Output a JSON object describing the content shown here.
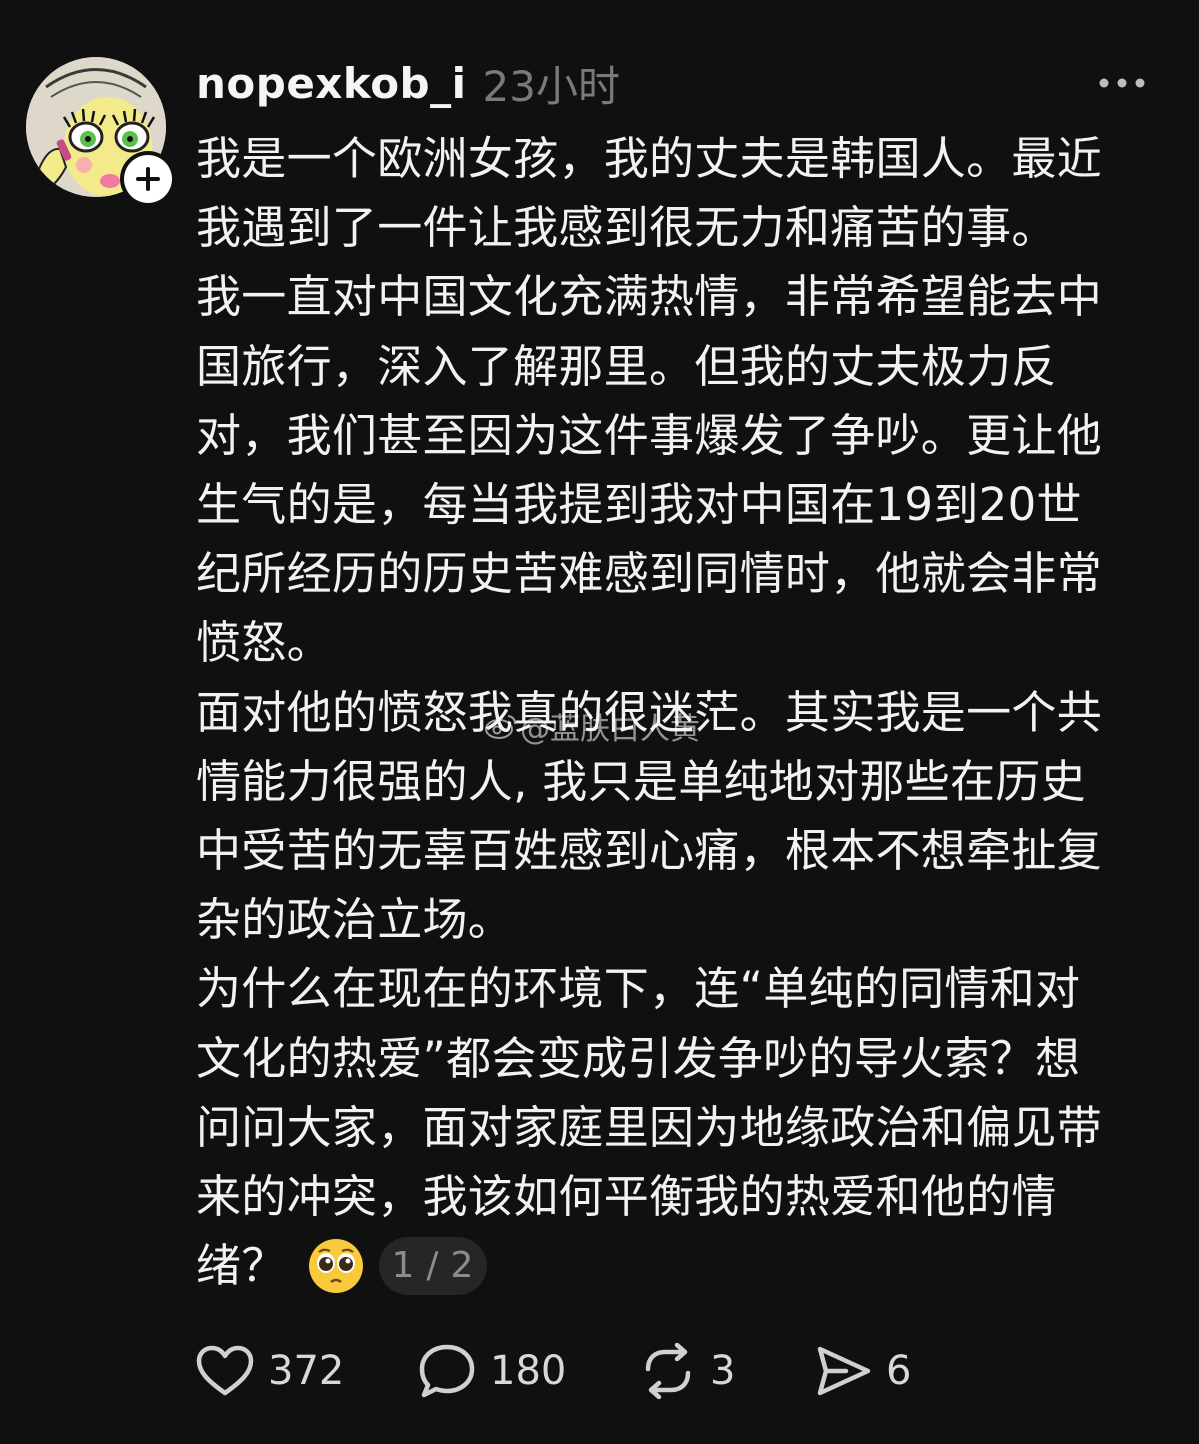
{
  "post": {
    "username": "nopexkob_i",
    "time": "23小时",
    "paragraphs": [
      "我是一个欧洲女孩，我的丈夫是韩国人。最近\n我遇到了一件让我感到很无力和痛苦的事。",
      "我一直对中国文化充满热情，非常希望能去中\n国旅行，深入了解那里。但我的丈夫极力反\n对，我们甚至因为这件事爆发了争吵。更让他\n生气的是，每当我提到我对中国在19到20世\n纪所经历的历史苦难感到同情时，他就会非常\n愤怒。",
      "面对他的愤怒我真的很迷茫。其实我是一个共\n情能力很强的人, 我只是单纯地对那些在历史\n中受苦的无辜百姓感到心痛，根本不想牵扯复\n杂的政治立场。",
      "为什么在现在的环境下，连“单纯的同情和对\n文化的热爱”都会变成引发争吵的导火索？想\n问问大家，面对家庭里因为地缘政治和偏见带\n来的冲突，我该如何平衡我的热爱和他的情"
    ],
    "last_line_text": "绪？",
    "emoji": "pleading-face",
    "page_indicator": "1 / 2",
    "watermark": "@蓝肤白人黄"
  },
  "actions": {
    "likes": "372",
    "comments": "180",
    "reposts": "3",
    "shares": "6"
  },
  "colors": {
    "background": "#101010",
    "text": "#f2f2f2",
    "muted": "#7a7a7a"
  }
}
